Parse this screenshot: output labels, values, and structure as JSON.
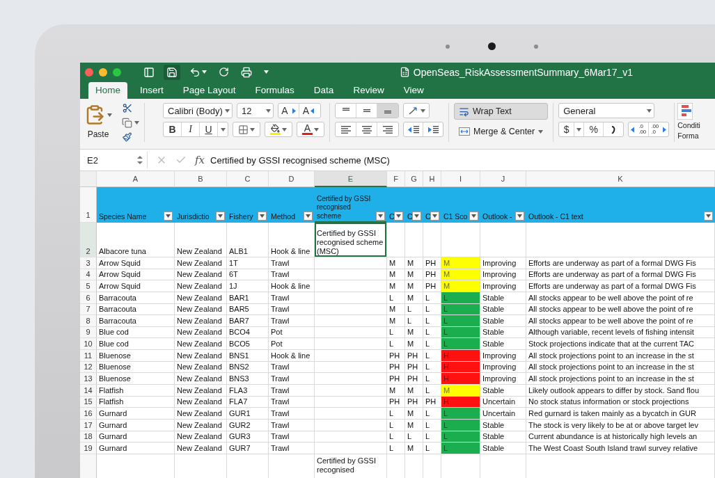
{
  "window": {
    "title": "OpenSeas_RiskAssessmentSummary_6Mar17_v1"
  },
  "ribbon_tabs": [
    {
      "label": "Home",
      "selected": true
    },
    {
      "label": "Insert",
      "selected": false
    },
    {
      "label": "Page Layout",
      "selected": false
    },
    {
      "label": "Formulas",
      "selected": false
    },
    {
      "label": "Data",
      "selected": false
    },
    {
      "label": "Review",
      "selected": false
    },
    {
      "label": "View",
      "selected": false
    }
  ],
  "ribbon": {
    "paste": "Paste",
    "font": {
      "name": "Calibri (Body)",
      "size": "12",
      "grow": "A",
      "shrink": "A",
      "bold": "B",
      "italic": "I",
      "underline": "U",
      "font_color_button": "A"
    },
    "vertical_align": [
      {
        "kind": "top",
        "selected": false
      },
      {
        "kind": "middle",
        "selected": false
      },
      {
        "kind": "bottom",
        "selected": true
      }
    ],
    "horizontal_align": [
      {
        "kind": "left",
        "selected": false
      },
      {
        "kind": "center",
        "selected": false
      },
      {
        "kind": "right",
        "selected": false
      }
    ],
    "wrap_text": {
      "label": "Wrap Text",
      "on": true
    },
    "merge": "Merge & Center",
    "number": {
      "format": "General",
      "currency": "$",
      "percent": "%",
      "increase_decimal": [
        ".0",
        ".00"
      ],
      "decrease_decimal": [
        ".00",
        ".0"
      ]
    },
    "conditional_formatting": [
      "Conditi",
      "Forma"
    ]
  },
  "formula_bar": {
    "name_box": "E2",
    "fx": "fx",
    "formula": "Certified by GSSI recognised scheme (MSC)"
  },
  "sheet": {
    "columns": [
      {
        "label": "A",
        "selected": false
      },
      {
        "label": "B",
        "selected": false
      },
      {
        "label": "C",
        "selected": false
      },
      {
        "label": "D",
        "selected": false
      },
      {
        "label": "E",
        "selected": true
      },
      {
        "label": "F",
        "selected": false
      },
      {
        "label": "G",
        "selected": false
      },
      {
        "label": "H",
        "selected": false
      },
      {
        "label": "I",
        "selected": false
      },
      {
        "label": "J",
        "selected": false
      },
      {
        "label": "K",
        "selected": false
      }
    ],
    "header_row": {
      "number": "1",
      "cells": [
        "Species Name",
        "Jurisdictio",
        "Fishery",
        "Method",
        "Certified by GSSI recognised scheme",
        "C",
        "C",
        "C",
        "C1 Sco",
        "Outlook -",
        "Outlook - C1 text"
      ]
    },
    "rows": [
      {
        "number": "2",
        "selected": true,
        "species": "Albacore tuna",
        "jurisdiction": "New Zealand",
        "fishery": "ALB1",
        "method": "Hook & line",
        "certification": "Certified by GSSI recognised scheme (MSC)"
      },
      {
        "number": "3",
        "selected": false,
        "species": "Arrow Squid",
        "jurisdiction": "New Zealand",
        "fishery": "1T",
        "method": "Trawl",
        "f": "M",
        "g": "M",
        "h": "PH",
        "score": {
          "text": "M",
          "color": "#ffff00"
        },
        "outlook": "Improving",
        "outlook_text": "Efforts are underway as part of a formal DWG Fis"
      },
      {
        "number": "4",
        "selected": false,
        "species": "Arrow Squid",
        "jurisdiction": "New Zealand",
        "fishery": "6T",
        "method": "Trawl",
        "f": "M",
        "g": "M",
        "h": "PH",
        "score": {
          "text": "M",
          "color": "#ffff00"
        },
        "outlook": "Improving",
        "outlook_text": "Efforts are underway as part of a formal DWG Fis"
      },
      {
        "number": "5",
        "selected": false,
        "species": "Arrow Squid",
        "jurisdiction": "New Zealand",
        "fishery": "1J",
        "method": "Hook & line",
        "f": "M",
        "g": "M",
        "h": "PH",
        "score": {
          "text": "M",
          "color": "#ffff00"
        },
        "outlook": "Improving",
        "outlook_text": "Efforts are underway as part of a formal DWG Fis"
      },
      {
        "number": "6",
        "selected": false,
        "species": "Barracouta",
        "jurisdiction": "New Zealand",
        "fishery": "BAR1",
        "method": "Trawl",
        "f": "L",
        "g": "M",
        "h": "L",
        "score": {
          "text": "L",
          "color": "#1bae4f"
        },
        "outlook": "Stable",
        "outlook_text": "All stocks appear to be well above the point of re"
      },
      {
        "number": "7",
        "selected": false,
        "species": "Barracouta",
        "jurisdiction": "New Zealand",
        "fishery": "BAR5",
        "method": "Trawl",
        "f": "M",
        "g": "L",
        "h": "L",
        "score": {
          "text": "L",
          "color": "#1bae4f"
        },
        "outlook": "Stable",
        "outlook_text": "All stocks appear to be well above the point of re"
      },
      {
        "number": "8",
        "selected": false,
        "species": "Barracouta",
        "jurisdiction": "New Zealand",
        "fishery": "BAR7",
        "method": "Trawl",
        "f": "M",
        "g": "L",
        "h": "L",
        "score": {
          "text": "L",
          "color": "#1bae4f"
        },
        "outlook": "Stable",
        "outlook_text": "All stocks appear to be well above the point of re"
      },
      {
        "number": "9",
        "selected": false,
        "species": "Blue cod",
        "jurisdiction": "New Zealand",
        "fishery": "BCO4",
        "method": "Pot",
        "f": "L",
        "g": "M",
        "h": "L",
        "score": {
          "text": "L",
          "color": "#1bae4f"
        },
        "outlook": "Stable",
        "outlook_text": "Although variable, recent levels of fishing intensit"
      },
      {
        "number": "10",
        "selected": false,
        "species": "Blue cod",
        "jurisdiction": "New Zealand",
        "fishery": "BCO5",
        "method": "Pot",
        "f": "L",
        "g": "M",
        "h": "L",
        "score": {
          "text": "L",
          "color": "#1bae4f"
        },
        "outlook": "Stable",
        "outlook_text": "Stock projections indicate that at the current TAC"
      },
      {
        "number": "11",
        "selected": false,
        "species": "Bluenose",
        "jurisdiction": "New Zealand",
        "fishery": "BNS1",
        "method": "Hook & line",
        "f": "PH",
        "g": "PH",
        "h": "L",
        "score": {
          "text": "H",
          "color": "#ff1111"
        },
        "outlook": "Improving",
        "outlook_text": "All stock projections point to an increase in the st"
      },
      {
        "number": "12",
        "selected": false,
        "species": "Bluenose",
        "jurisdiction": "New Zealand",
        "fishery": "BNS2",
        "method": "Trawl",
        "f": "PH",
        "g": "PH",
        "h": "L",
        "score": {
          "text": "H",
          "color": "#ff1111"
        },
        "outlook": "Improving",
        "outlook_text": "All stock projections point to an increase in the st"
      },
      {
        "number": "13",
        "selected": false,
        "species": "Bluenose",
        "jurisdiction": "New Zealand",
        "fishery": "BNS3",
        "method": "Trawl",
        "f": "PH",
        "g": "PH",
        "h": "L",
        "score": {
          "text": "H",
          "color": "#ff1111"
        },
        "outlook": "Improving",
        "outlook_text": "All stock projections point to an increase in the st"
      },
      {
        "number": "14",
        "selected": false,
        "species": "Flatfish",
        "jurisdiction": "New Zealand",
        "fishery": "FLA3",
        "method": "Trawl",
        "f": "M",
        "g": "M",
        "h": "L",
        "score": {
          "text": "M",
          "color": "#ffff00"
        },
        "outlook": "Stable",
        "outlook_text": "Likely outlook appears to differ by stock. Sand flou"
      },
      {
        "number": "15",
        "selected": false,
        "species": "Flatfish",
        "jurisdiction": "New Zealand",
        "fishery": "FLA7",
        "method": "Trawl",
        "f": "PH",
        "g": "PH",
        "h": "PH",
        "score": {
          "text": "H",
          "color": "#ff1111"
        },
        "outlook": "Uncertain",
        "outlook_text": "No stock status information or stock projections"
      },
      {
        "number": "16",
        "selected": false,
        "species": "Gurnard",
        "jurisdiction": "New Zealand",
        "fishery": "GUR1",
        "method": "Trawl",
        "f": "L",
        "g": "M",
        "h": "L",
        "score": {
          "text": "L",
          "color": "#1bae4f"
        },
        "outlook": "Uncertain",
        "outlook_text": "Red gurnard is taken mainly as a bycatch in GUR"
      },
      {
        "number": "17",
        "selected": false,
        "species": "Gurnard",
        "jurisdiction": "New Zealand",
        "fishery": "GUR2",
        "method": "Trawl",
        "f": "L",
        "g": "M",
        "h": "L",
        "score": {
          "text": "L",
          "color": "#1bae4f"
        },
        "outlook": "Stable",
        "outlook_text": "The stock is very likely to be at or above target lev"
      },
      {
        "number": "18",
        "selected": false,
        "species": "Gurnard",
        "jurisdiction": "New Zealand",
        "fishery": "GUR3",
        "method": "Trawl",
        "f": "L",
        "g": "L",
        "h": "L",
        "score": {
          "text": "L",
          "color": "#1bae4f"
        },
        "outlook": "Stable",
        "outlook_text": "Current abundance is at historically high levels an"
      },
      {
        "number": "19",
        "selected": false,
        "species": "Gurnard",
        "jurisdiction": "New Zealand",
        "fishery": "GUR7",
        "method": "Trawl",
        "f": "L",
        "g": "M",
        "h": "L",
        "score": {
          "text": "L",
          "color": "#1bae4f"
        },
        "outlook": "Stable",
        "outlook_text": "The West Coast South Island trawl survey relative"
      },
      {
        "selected": false,
        "certification": "Certified by GSSI recognised"
      }
    ]
  }
}
